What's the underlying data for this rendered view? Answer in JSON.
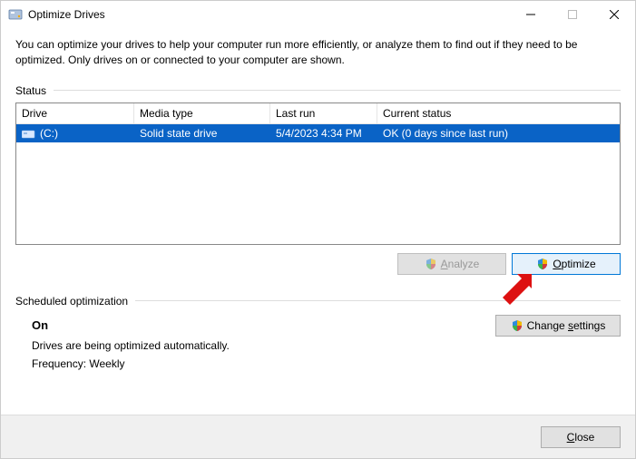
{
  "window": {
    "title": "Optimize Drives"
  },
  "intro": "You can optimize your drives to help your computer run more efficiently, or analyze them to find out if they need to be optimized. Only drives on or connected to your computer are shown.",
  "status_label": "Status",
  "table": {
    "headers": {
      "drive": "Drive",
      "media": "Media type",
      "last": "Last run",
      "status": "Current status"
    },
    "rows": [
      {
        "drive": "(C:)",
        "media": "Solid state drive",
        "last": "5/4/2023 4:34 PM",
        "status": "OK (0 days since last run)"
      }
    ]
  },
  "buttons": {
    "analyze": "Analyze",
    "optimize": "Optimize",
    "change": "Change settings",
    "close": "Close"
  },
  "sched": {
    "label": "Scheduled optimization",
    "state": "On",
    "text": "Drives are being optimized automatically.",
    "freq": "Frequency: Weekly"
  }
}
